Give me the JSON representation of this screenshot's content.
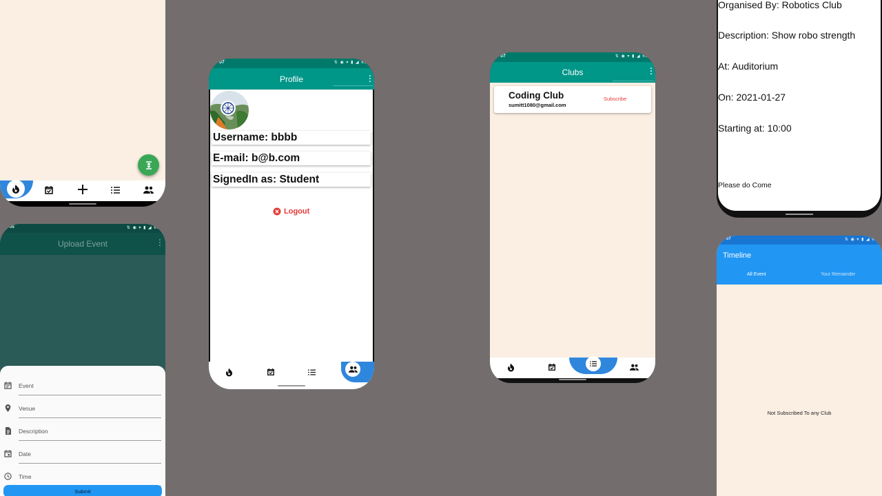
{
  "colors": {
    "background": "#736d6d",
    "teal": "#009688",
    "blue": "#2196f3",
    "nav_accent": "#2f86dd",
    "danger": "#e53935",
    "fab_green": "#3aa757",
    "cream": "#fbefe3"
  },
  "home_panel": {
    "fab_icon": "vertical-align-center-icon",
    "nav_icons": [
      "fire-icon",
      "event-check-icon",
      "plus-icon",
      "list-icon",
      "people-icon"
    ]
  },
  "upload_event": {
    "status_time": "05",
    "title": "Upload Event",
    "fields": [
      {
        "label": "Event",
        "icon": "event-note-icon"
      },
      {
        "label": "Venue",
        "icon": "location-pin-icon"
      },
      {
        "label": "Description",
        "icon": "description-icon"
      },
      {
        "label": "Date",
        "icon": "calendar-icon"
      },
      {
        "label": "Time",
        "icon": "clock-icon"
      }
    ],
    "submit_label": "Submit"
  },
  "profile": {
    "status_time": "07",
    "status_icons": "⇅ ◉ ▾ ▮ ◢ 63",
    "title": "Profile",
    "username": "Username: bbbb",
    "email": "E-mail: b@b.com",
    "signed_in_as": "SignedIn as: Student",
    "logout_label": "Logout"
  },
  "clubs": {
    "status_time": "07",
    "status_icons": "⇅ ◉ ▾ ▮ ◢ 63",
    "title": "Clubs",
    "club": {
      "name": "Coding Club",
      "email": "sumitt1080@gmail.com",
      "action": "Subscribe"
    }
  },
  "event_detail": {
    "organised_by": "Organised By: Robotics Club",
    "description": "Description: Show robo strength",
    "at": "At: Auditorium",
    "on": "On: 2021-01-27",
    "starting_at": "Starting at: 10:00",
    "note": "Please do Come"
  },
  "timeline": {
    "status_time": "07",
    "title": "Timeline",
    "tabs": [
      "All Event",
      "Your Remainder"
    ],
    "active_tab": "All Event",
    "empty_message": "Not Subscribed To any Club"
  }
}
